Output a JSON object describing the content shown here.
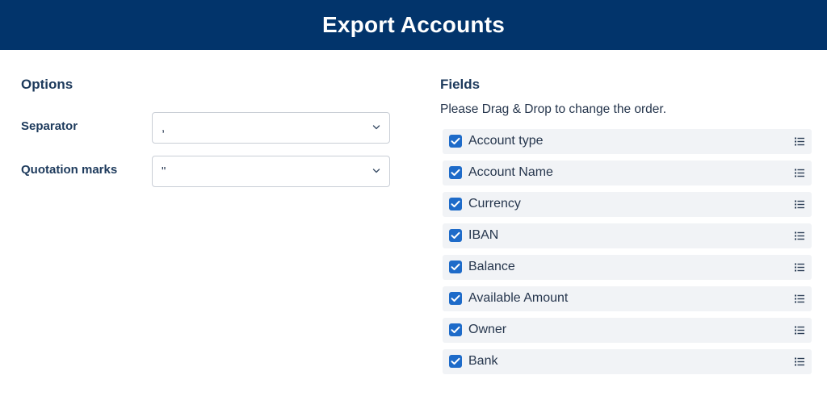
{
  "header": {
    "title": "Export Accounts"
  },
  "options": {
    "title": "Options",
    "separator": {
      "label": "Separator",
      "value": ","
    },
    "quotation": {
      "label": "Quotation marks",
      "value": "\""
    }
  },
  "fields": {
    "title": "Fields",
    "hint": "Please Drag & Drop to change the order.",
    "items": [
      {
        "label": "Account type",
        "checked": true
      },
      {
        "label": "Account Name",
        "checked": true
      },
      {
        "label": "Currency",
        "checked": true
      },
      {
        "label": "IBAN",
        "checked": true
      },
      {
        "label": "Balance",
        "checked": true
      },
      {
        "label": "Available Amount",
        "checked": true
      },
      {
        "label": "Owner",
        "checked": true
      },
      {
        "label": "Bank",
        "checked": true
      }
    ]
  },
  "icons": {
    "select_caret": "chevron-down-icon",
    "checkbox": "checkmark-icon",
    "drag_handle": "drag-handle-icon"
  },
  "colors": {
    "header_bg": "#02346b",
    "accent": "#1e6bc9",
    "row_bg": "#f1f3f6"
  }
}
